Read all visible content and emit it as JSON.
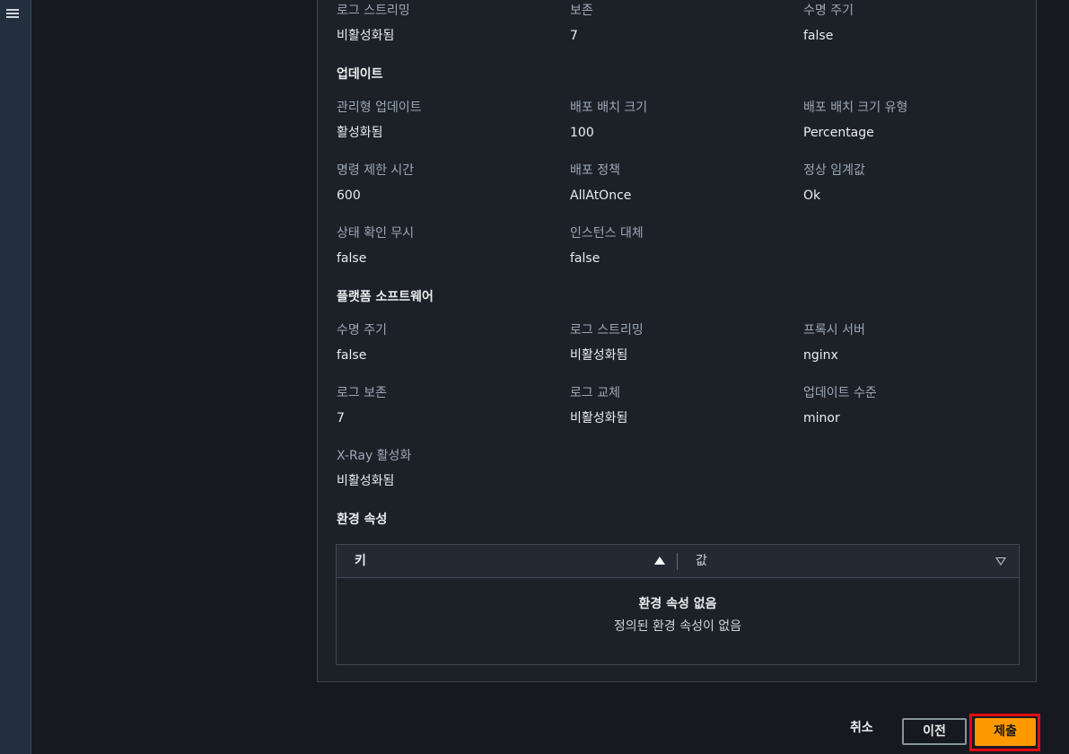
{
  "top": [
    {
      "key": "로그 스트리밍",
      "value": "비활성화됨"
    },
    {
      "key": "보존",
      "value": "7"
    },
    {
      "key": "수명 주기",
      "value": "false"
    }
  ],
  "updates": {
    "title": "업데이트",
    "items": [
      {
        "key": "관리형 업데이트",
        "value": "활성화됨"
      },
      {
        "key": "배포 배치 크기",
        "value": "100"
      },
      {
        "key": "배포 배치 크기 유형",
        "value": "Percentage"
      },
      {
        "key": "명령 제한 시간",
        "value": "600"
      },
      {
        "key": "배포 정책",
        "value": "AllAtOnce"
      },
      {
        "key": "정상 임계값",
        "value": "Ok"
      },
      {
        "key": "상태 확인 무시",
        "value": "false"
      },
      {
        "key": "인스턴스 대체",
        "value": "false"
      }
    ]
  },
  "platform": {
    "title": "플랫폼 소프트웨어",
    "items": [
      {
        "key": "수명 주기",
        "value": "false"
      },
      {
        "key": "로그 스트리밍",
        "value": "비활성화됨"
      },
      {
        "key": "프록시 서버",
        "value": "nginx"
      },
      {
        "key": "로그 보존",
        "value": "7"
      },
      {
        "key": "로그 교체",
        "value": "비활성화됨"
      },
      {
        "key": "업데이트 수준",
        "value": "minor"
      },
      {
        "key": "X-Ray 활성화",
        "value": "비활성화됨"
      }
    ]
  },
  "env": {
    "title": "환경 속성",
    "col_key": "키",
    "col_value": "값",
    "empty_title": "환경 속성 없음",
    "empty_desc": "정의된 환경 속성이 없음"
  },
  "actions": {
    "cancel": "취소",
    "previous": "이전",
    "submit": "제출"
  },
  "colors": {
    "accent": "#ff9900",
    "highlight": "#e00c14"
  },
  "icons": [
    "menu-icon",
    "sort-ascending-icon",
    "sort-descending-icon"
  ]
}
